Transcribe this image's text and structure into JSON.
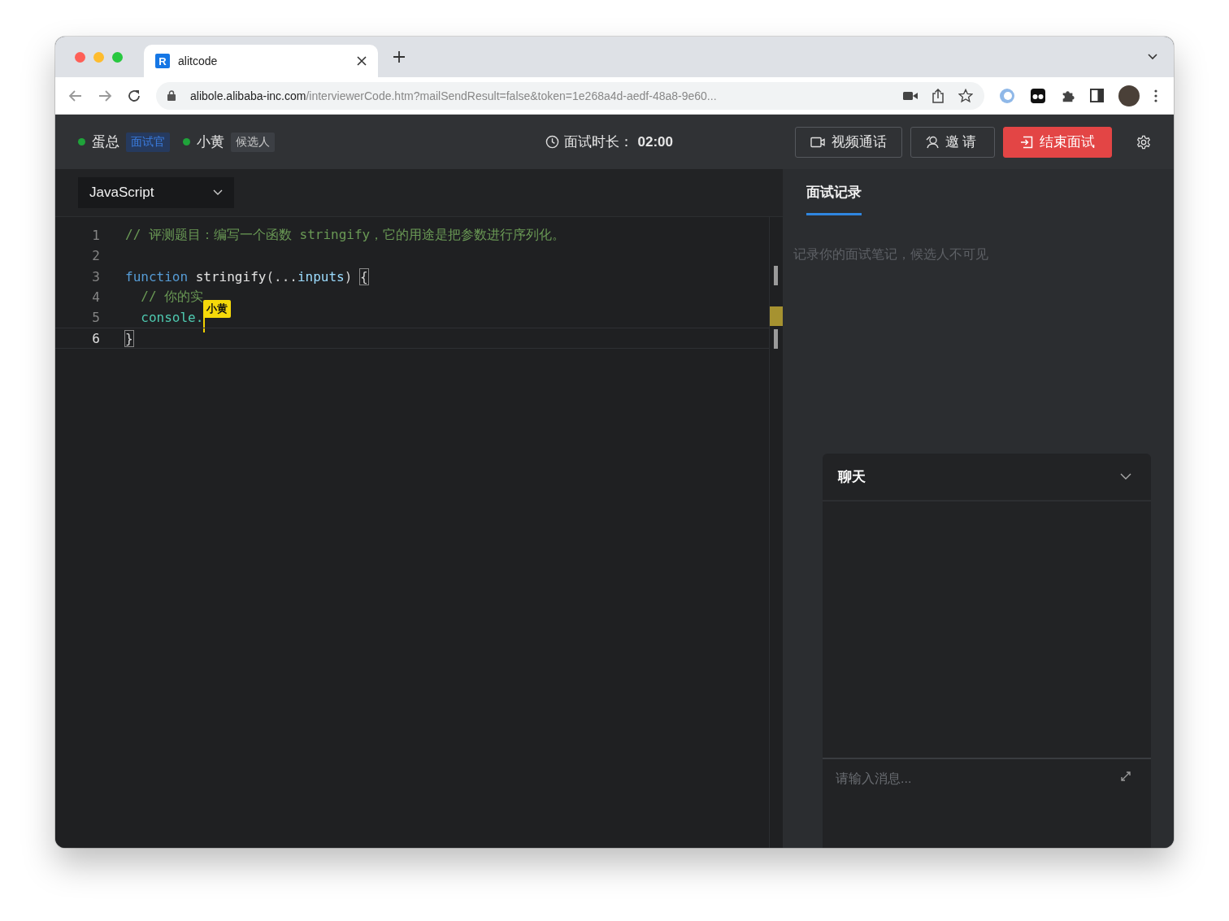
{
  "browser": {
    "tab": {
      "favicon": "R",
      "title": "alitcode"
    },
    "url": {
      "host": "alibole.alibaba-inc.com",
      "path": "/interviewerCode.htm?mailSendResult=false&token=1e268a4d-aedf-48a8-9e60..."
    }
  },
  "header": {
    "participants": [
      {
        "name": "蛋总",
        "role": "面试官",
        "kind": "interviewer",
        "color": "#1fa33a"
      },
      {
        "name": "小黄",
        "role": "候选人",
        "kind": "candidate",
        "color": "#1fa33a"
      }
    ],
    "timer": {
      "label": "面试时长：",
      "value": "02:00"
    },
    "buttons": [
      {
        "label": "视频通话",
        "kind": "video"
      },
      {
        "label": "邀请",
        "kind": "invite"
      },
      {
        "label": "结束面试",
        "kind": "end"
      }
    ]
  },
  "editor": {
    "language": "JavaScript",
    "lines": [
      {
        "number": "1",
        "current": false,
        "tokens": [
          {
            "kind": "comment",
            "text": "// 评测题目：编写一个函数 stringify，它的用途是把参数进行序列化。"
          }
        ]
      },
      {
        "number": "2",
        "current": false
      },
      {
        "number": "3",
        "current": false,
        "tokens": [
          {
            "kind": "keyword",
            "text": "function "
          },
          {
            "kind": "func",
            "text": "stringify"
          },
          {
            "kind": "plain",
            "text": "(..."
          },
          {
            "kind": "param",
            "text": "inputs"
          },
          {
            "kind": "plain",
            "text": ") "
          },
          {
            "kind": "bracket",
            "text": "{"
          }
        ]
      },
      {
        "number": "4",
        "current": false,
        "tokens": [
          {
            "kind": "comment",
            "text": "  // 你的实"
          }
        ]
      },
      {
        "number": "5",
        "current": false,
        "tokens": [
          {
            "kind": "object",
            "text": "  console."
          }
        ],
        "cursor": {
          "label": "小黄"
        }
      },
      {
        "number": "6",
        "current": true,
        "tokens": [
          {
            "kind": "bracket",
            "text": "}"
          }
        ]
      }
    ]
  },
  "notes": {
    "tab": {
      "label": "面试记录",
      "selected": true
    },
    "placeholder": "记录你的面试笔记，候选人不可见"
  },
  "chat": {
    "title": "聊天",
    "placeholder": "请输入消息..."
  }
}
